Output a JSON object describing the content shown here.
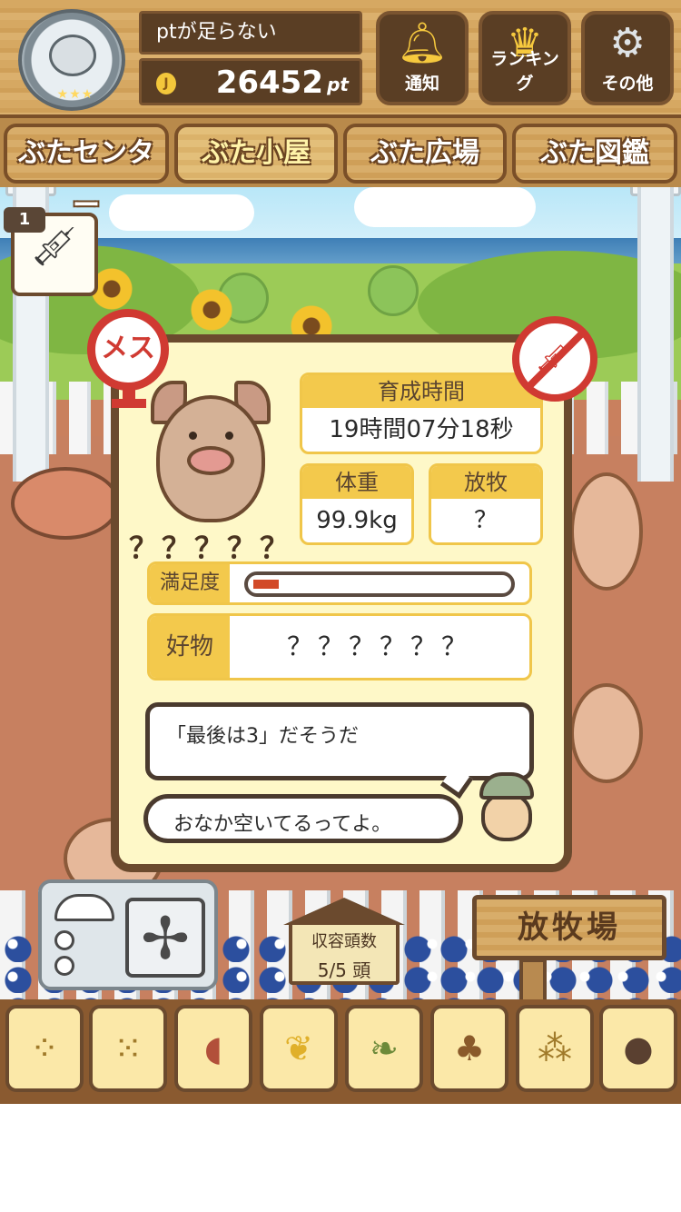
{
  "header": {
    "pt_warning": "ptが足らない",
    "points": "26452",
    "points_unit": "pt",
    "coin_symbol": "J",
    "buttons": [
      {
        "label": "通知",
        "icon": "bell-icon"
      },
      {
        "label": "ランキング",
        "icon": "crown-icon"
      },
      {
        "label": "その他",
        "icon": "gear-icon"
      }
    ]
  },
  "tabs": [
    {
      "label": "ぶたセンター",
      "active": false
    },
    {
      "label": "ぶた小屋",
      "active": true
    },
    {
      "label": "ぶた広場",
      "active": false
    },
    {
      "label": "ぶた図鑑",
      "active": false
    }
  ],
  "injection": {
    "count": "1",
    "icon": "syringe-icon"
  },
  "pig": {
    "gender_label": "メス",
    "name": "？？？？？",
    "stats": {
      "time_label": "育成時間",
      "time_value": "19時間07分18秒",
      "weight_label": "体重",
      "weight_value": "99.9kg",
      "graze_label": "放牧",
      "graze_value": "？"
    },
    "satisfaction_label": "満足度",
    "satisfaction_level": 0.1,
    "favorite_label": "好物",
    "favorite_value": "？？？？？？"
  },
  "messages": {
    "hint": "「最後は3」だそうだ",
    "status": "おなか空いてるってよ。"
  },
  "capacity": {
    "label": "収容頭数",
    "value": "5/5 頭"
  },
  "pasture_sign": "放牧場",
  "feeds": [
    "feed-pellet-icon",
    "feed-grain-icon",
    "sweet-potato-icon",
    "corn-icon",
    "beans-icon",
    "acorn-icon",
    "plate-grain-icon",
    "plate-meatball-icon"
  ],
  "colors": {
    "accent": "#f3c94c",
    "alert": "#d03a32",
    "wood_dark": "#6b4a2e"
  }
}
